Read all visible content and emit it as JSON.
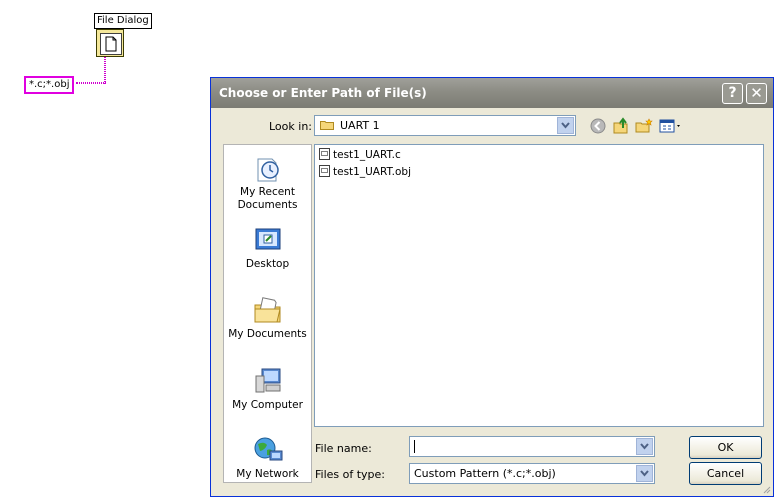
{
  "diagram": {
    "node_label": "File Dialog",
    "node_icon": "file-icon",
    "pattern_constant": "*.c;*.obj"
  },
  "dialog": {
    "title": "Choose or Enter Path of File(s)",
    "help_label": "?",
    "close_label": "✕",
    "look_in_label": "Look in:",
    "look_in_value": "UART 1",
    "toolbar_icons": [
      "back-icon",
      "up-folder-icon",
      "new-folder-icon",
      "view-menu-icon"
    ],
    "places": [
      {
        "label": "My Recent Documents",
        "icon": "recent-documents-icon"
      },
      {
        "label": "Desktop",
        "icon": "desktop-icon"
      },
      {
        "label": "My Documents",
        "icon": "my-documents-icon"
      },
      {
        "label": "My Computer",
        "icon": "my-computer-icon"
      },
      {
        "label": "My Network",
        "icon": "my-network-icon"
      }
    ],
    "files": [
      {
        "name": "test1_UART.c",
        "icon": "file-icon"
      },
      {
        "name": "test1_UART.obj",
        "icon": "file-icon"
      }
    ],
    "file_name_label": "File name:",
    "file_name_value": "",
    "files_of_type_label": "Files of type:",
    "files_of_type_value": "Custom Pattern (*.c;*.obj)",
    "ok_label": "OK",
    "cancel_label": "Cancel"
  },
  "colors": {
    "wire": "#d000d0",
    "titlebar": "#8c8c84",
    "dialog_bg": "#ece9d8",
    "input_border": "#7f9db9"
  }
}
